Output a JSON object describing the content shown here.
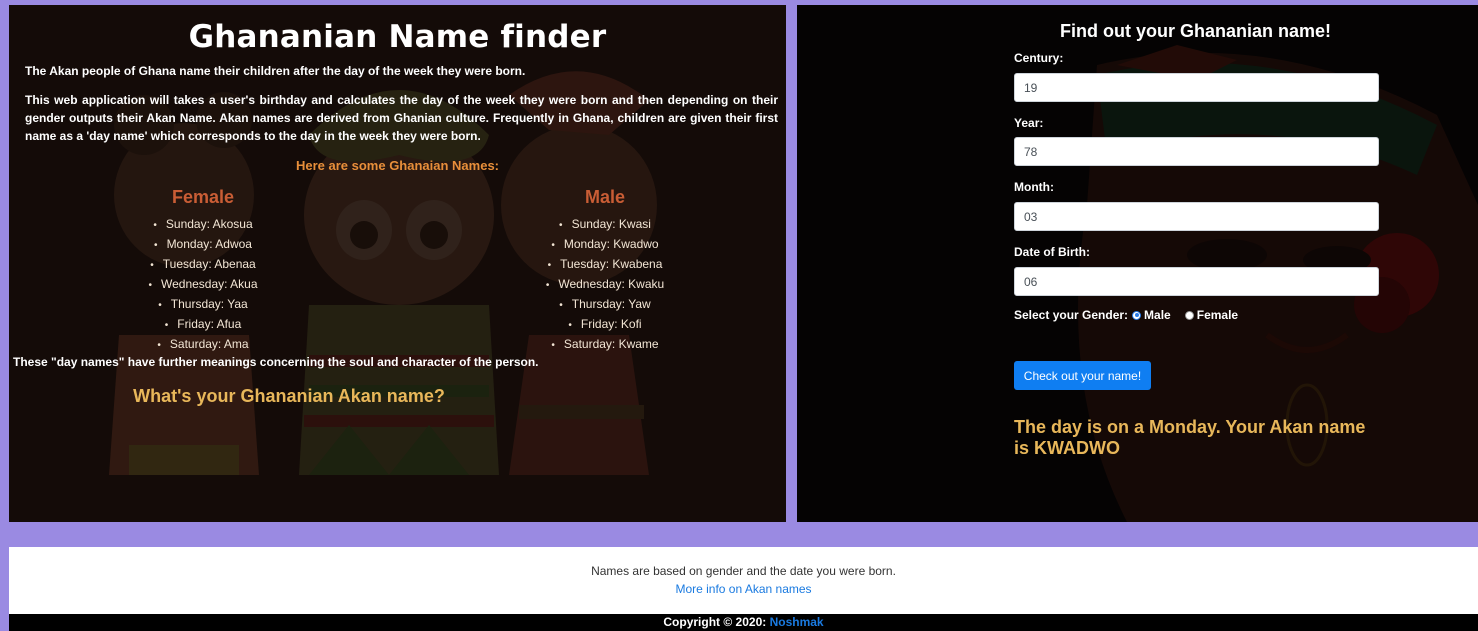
{
  "left": {
    "title": "Ghananian Name finder",
    "intro_1": "The Akan people of Ghana name their children after the day of the week they were born.",
    "intro_2": "This web application will takes a user's birthday and calculates the day of the week they were born and then depending on their gender outputs their Akan Name. Akan names are derived from Ghanian culture. Frequently in Ghana, children are given their first name as a 'day name' which corresponds to the day in the week they were born.",
    "names_heading": "Here are some Ghanaian Names:",
    "female": {
      "title": "Female",
      "items": [
        "Sunday: Akosua",
        "Monday: Adwoa",
        "Tuesday: Abenaa",
        "Wednesday: Akua",
        "Thursday: Yaa",
        "Friday: Afua",
        "Saturday: Ama"
      ]
    },
    "male": {
      "title": "Male",
      "items": [
        "Sunday: Kwasi",
        "Monday: Kwadwo",
        "Tuesday: Kwabena",
        "Wednesday: Kwaku",
        "Thursday: Yaw",
        "Friday: Kofi",
        "Saturday: Kwame"
      ]
    },
    "meanings": "These \"day names\" have further meanings concerning the soul and character of the person.",
    "question": "What's your Ghananian Akan name?"
  },
  "form": {
    "title": "Find out your Ghananian name!",
    "century_label": "Century:",
    "century_value": "19",
    "year_label": "Year:",
    "year_value": "78",
    "month_label": "Month:",
    "month_value": "03",
    "dob_label": "Date of Birth:",
    "dob_value": "06",
    "gender_label": "Select your Gender:",
    "male_label": "Male",
    "female_label": "Female",
    "selected_gender": "Male",
    "submit_label": "Check out your name!",
    "result": "The day is on a Monday. Your Akan name is KWADWO"
  },
  "footer": {
    "text": "Names are based on gender and the date you were born.",
    "link": "More info on Akan names",
    "copyright_prefix": "Copyright © 2020: ",
    "copyright_author": "Noshmak"
  },
  "colors": {
    "page_bg": "#9a8ae2",
    "accent_orange": "#e88f3a",
    "accent_gold": "#e8b75a",
    "column_title": "#c95d35",
    "button": "#0f7ef2",
    "link": "#1a7ae0"
  }
}
